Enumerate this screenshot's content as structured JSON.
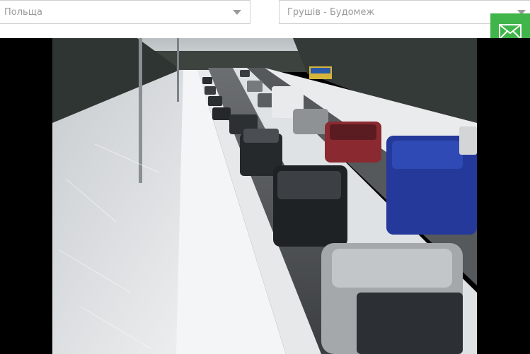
{
  "filters": {
    "country": {
      "selected": "Польща"
    },
    "crossing": {
      "selected": "Грушів - Будомеж"
    }
  },
  "contact": {
    "icon": "mail-icon"
  },
  "camera": {
    "description_icon": "camera-feed"
  },
  "colors": {
    "accent_green": "#40b549",
    "select_border": "#cfcfcf",
    "select_text": "#9a9a9a",
    "frame_bg": "#000000"
  }
}
